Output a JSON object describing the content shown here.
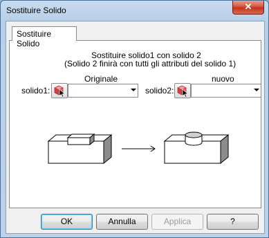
{
  "window": {
    "title": "Sostituire Solido",
    "close_label": "✕"
  },
  "tab": {
    "label": "Sostituire Solido"
  },
  "description": {
    "line1": "Sostituire solido1 con solido 2",
    "line2": "(Solido 2 finirà con tutti gli attributi del solido 1)"
  },
  "solid1": {
    "header": "Originale",
    "label": "solido1:",
    "value": ""
  },
  "solid2": {
    "header": "nuovo",
    "label": "solido2:",
    "value": ""
  },
  "buttons": {
    "ok": "OK",
    "cancel": "Annulla",
    "apply": "Applica",
    "help": "?"
  }
}
